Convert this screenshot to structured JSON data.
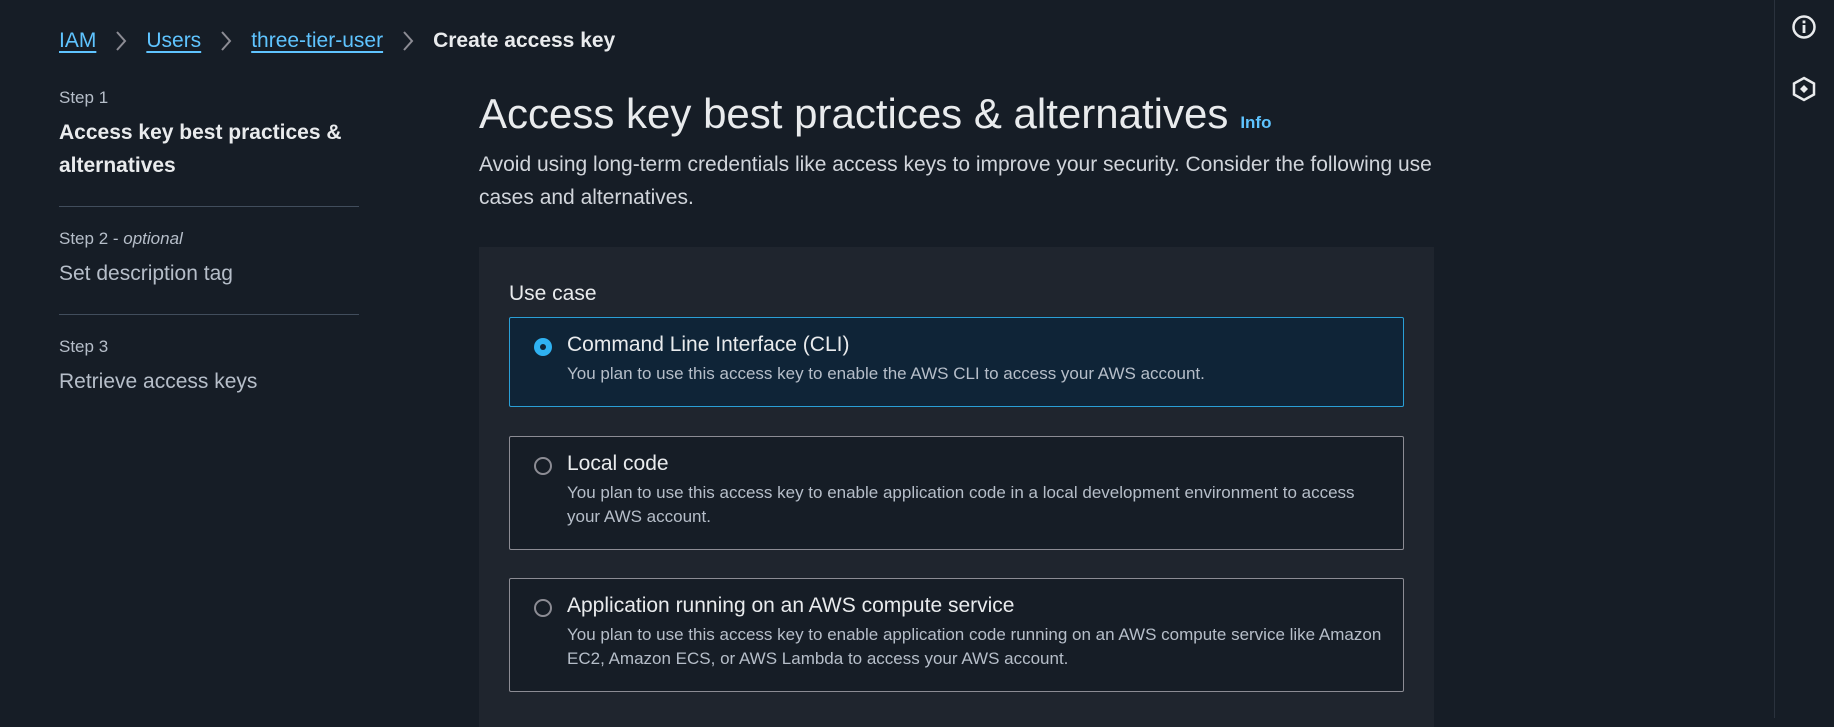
{
  "breadcrumb": {
    "items": [
      "IAM",
      "Users",
      "three-tier-user"
    ],
    "current": "Create access key"
  },
  "steps": [
    {
      "label": "Step 1",
      "optional": "",
      "title": "Access key best practices & alternatives"
    },
    {
      "label": "Step 2 - ",
      "optional": "optional",
      "title": "Set description tag"
    },
    {
      "label": "Step 3",
      "optional": "",
      "title": "Retrieve access keys"
    }
  ],
  "main": {
    "title": "Access key best practices & alternatives",
    "info": "Info",
    "description": "Avoid using long-term credentials like access keys to improve your security. Consider the following use cases and alternatives."
  },
  "use_case": {
    "label": "Use case",
    "options": [
      {
        "title": "Command Line Interface (CLI)",
        "description": "You plan to use this access key to enable the AWS CLI to access your AWS account.",
        "selected": true
      },
      {
        "title": "Local code",
        "description": "You plan to use this access key to enable application code in a local development environment to access your AWS account.",
        "selected": false
      },
      {
        "title": "Application running on an AWS compute service",
        "description": "You plan to use this access key to enable application code running on an AWS compute service like Amazon EC2, Amazon ECS, or AWS Lambda to access your AWS account.",
        "selected": false
      }
    ]
  },
  "rail": {
    "icons": [
      "info-circle-icon",
      "feedback-hex-icon"
    ]
  },
  "colors": {
    "background": "#161d26",
    "link": "#5fc4ff",
    "selected_border": "#2a9fd6",
    "selected_bg": "#0f2437"
  }
}
